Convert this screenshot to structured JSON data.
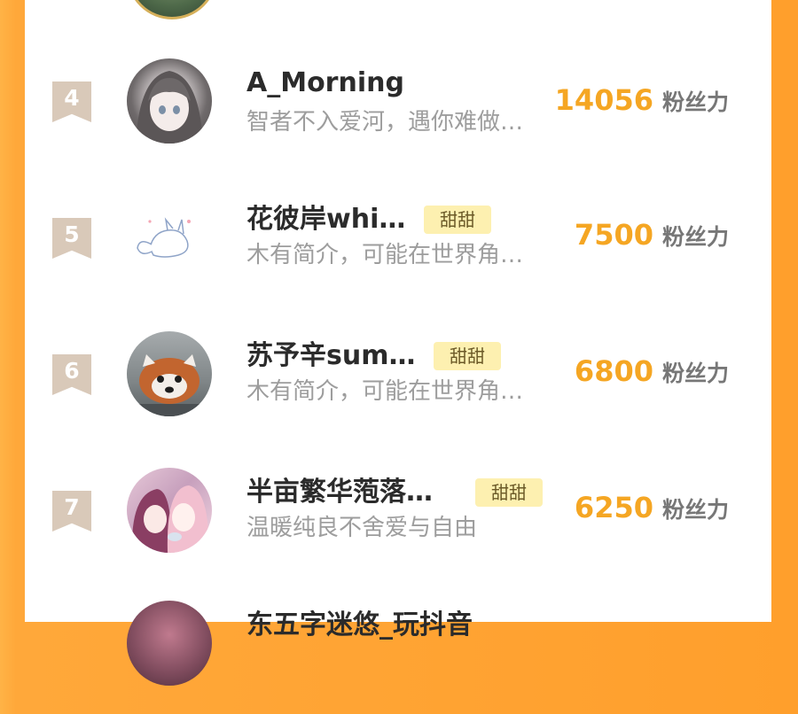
{
  "ranking": [
    {
      "rank": "4",
      "name": "A_Morning",
      "badge": "",
      "bio": "智者不入爱河，遇你难做…",
      "score": "14056",
      "unit": "粉丝力"
    },
    {
      "rank": "5",
      "name": "花彼岸whi…",
      "badge": "甜甜",
      "bio": "木有简介，可能在世界角…",
      "score": "7500",
      "unit": "粉丝力"
    },
    {
      "rank": "6",
      "name": "苏予辛sum…",
      "badge": "甜甜",
      "bio": "木有简介，可能在世界角…",
      "score": "6800",
      "unit": "粉丝力"
    },
    {
      "rank": "7",
      "name": "半亩繁华萢落…",
      "badge": "甜甜",
      "bio": "温暖纯良不舍爱与自由",
      "score": "6250",
      "unit": "粉丝力"
    },
    {
      "rank": "",
      "name": "东五字迷悠_玩抖音",
      "badge": "",
      "bio": "",
      "score": "",
      "unit": ""
    }
  ]
}
